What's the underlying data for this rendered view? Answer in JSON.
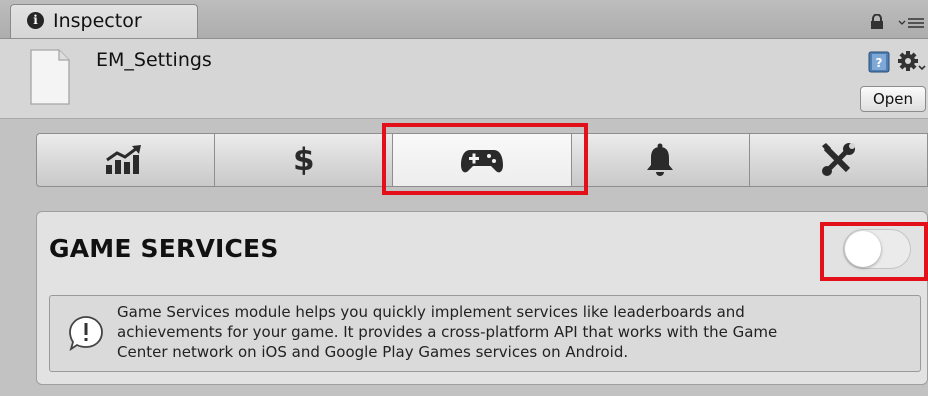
{
  "window": {
    "tab_label": "Inspector",
    "tab_icon": "info-icon",
    "lock_icon": "lock-icon",
    "menu_icon": "tab-menu-icon"
  },
  "header": {
    "asset_name": "EM_Settings",
    "asset_icon": "file-icon",
    "open_button_label": "Open"
  },
  "toolbar": {
    "buttons": [
      {
        "icon": "chart-icon",
        "active": false
      },
      {
        "icon": "dollar-icon",
        "label": "$",
        "active": false
      },
      {
        "icon": "gamepad-icon",
        "active": true
      },
      {
        "icon": "bell-icon",
        "active": false
      },
      {
        "icon": "tools-icon",
        "active": false
      }
    ]
  },
  "module": {
    "title": "GAME SERVICES",
    "enabled": false,
    "help_lines": [
      "Game Services module helps you quickly implement services like leaderboards and",
      "achievements for your game. It provides a cross-platform API that works with the Game",
      "Center network on iOS and Google Play Games services on Android."
    ]
  },
  "colors": {
    "highlight": "#e3101a",
    "background": "#c2c2c2",
    "panel": "#e2e2e2"
  }
}
